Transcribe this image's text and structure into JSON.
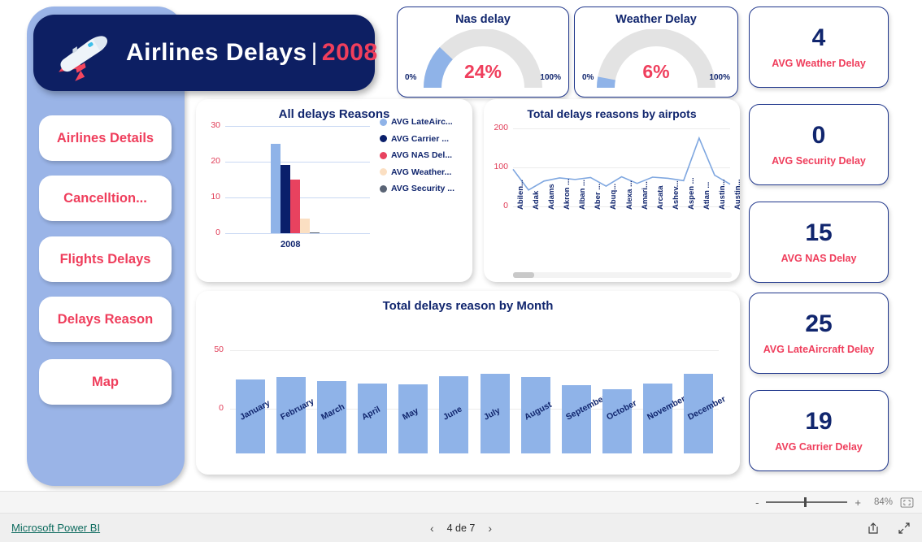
{
  "header": {
    "title_main": "Airlines Delays",
    "title_separator": "|",
    "title_year": "2008",
    "plane_icon": "airplane-icon"
  },
  "sidebar": {
    "items": [
      {
        "label": "Airlines Details"
      },
      {
        "label": "Cancelltion..."
      },
      {
        "label": "Flights Delays"
      },
      {
        "label": "Delays Reason"
      },
      {
        "label": "Map"
      }
    ]
  },
  "gauges": [
    {
      "title": "Nas delay",
      "value_label": "24%",
      "value": 24,
      "min_label": "0%",
      "max_label": "100%"
    },
    {
      "title": "Weather Delay",
      "value_label": "6%",
      "value": 6,
      "min_label": "0%",
      "max_label": "100%"
    }
  ],
  "kpis": [
    {
      "value": "4",
      "label": "AVG Weather Delay"
    },
    {
      "value": "0",
      "label": "AVG Security Delay"
    },
    {
      "value": "15",
      "label": "AVG NAS Delay"
    },
    {
      "value": "25",
      "label": "AVG LateAircraft Delay"
    },
    {
      "value": "19",
      "label": "AVG Carrier Delay"
    }
  ],
  "colors": {
    "navy": "#11266e",
    "banner_navy": "#0d1f63",
    "red": "#ef3e5c",
    "sidebar_blue": "#9ab4e7",
    "bar_light_blue": "#8fb3e8",
    "bar_navy": "#0a1f6b",
    "bar_red": "#e8425f",
    "bar_peach": "#fbdfc2",
    "bar_slate": "#5a6475",
    "gauge_track": "#e3e3e3",
    "link_teal": "#0d6b5e"
  },
  "chart_data": [
    {
      "id": "all-delays-reasons",
      "type": "bar",
      "title": "All delays Reasons",
      "xlabel": "",
      "ylabel": "",
      "categories": [
        "2008"
      ],
      "ylim": [
        0,
        30
      ],
      "yticks": [
        0,
        10,
        20,
        30
      ],
      "grid": true,
      "legend_position": "right",
      "series": [
        {
          "name": "AVG LateAirc...",
          "full_name": "AVG LateAircraft Delay",
          "values": [
            25
          ],
          "color": "#8fb3e8"
        },
        {
          "name": "AVG Carrier ...",
          "full_name": "AVG Carrier Delay",
          "values": [
            19
          ],
          "color": "#0a1f6b"
        },
        {
          "name": "AVG NAS Del...",
          "full_name": "AVG NAS Delay",
          "values": [
            15
          ],
          "color": "#e8425f"
        },
        {
          "name": "AVG Weather...",
          "full_name": "AVG Weather Delay",
          "values": [
            4
          ],
          "color": "#fbdfc2"
        },
        {
          "name": "AVG Security ...",
          "full_name": "AVG Security Delay",
          "values": [
            0.3
          ],
          "color": "#5a6475"
        }
      ]
    },
    {
      "id": "total-delays-by-airports",
      "type": "line",
      "title": "Total delays reasons by airpots",
      "xlabel": "",
      "ylabel": "",
      "ylim": [
        0,
        200
      ],
      "yticks": [
        0,
        100,
        200
      ],
      "grid": true,
      "legend_position": "none",
      "categories": [
        "Abilen...",
        "Adak",
        "Adams",
        "Akron ...",
        "Alban ...",
        "Aber ...",
        "Abuq...",
        "Alexa ...",
        "Amari...",
        "Arcata",
        "Ashev...",
        "Aspen ...",
        "Atlan ...",
        "Austin...",
        "Austin..."
      ],
      "values": [
        95,
        42,
        65,
        73,
        69,
        74,
        52,
        76,
        59,
        75,
        72,
        66,
        175,
        80,
        57
      ],
      "line_color": "#7fa7e0",
      "has_horizontal_scrollbar": true
    },
    {
      "id": "total-delays-by-month",
      "type": "bar",
      "title": "Total delays reason by Month",
      "xlabel": "",
      "ylabel": "",
      "ylim": [
        0,
        75
      ],
      "yticks": [
        0,
        50
      ],
      "grid": true,
      "legend_position": "none",
      "categories": [
        "January",
        "February",
        "March",
        "April",
        "May",
        "June",
        "July",
        "August",
        "September",
        "October",
        "November",
        "December"
      ],
      "values": [
        63,
        65,
        62,
        60,
        59,
        66,
        68,
        65,
        58,
        55,
        60,
        68
      ],
      "bar_color": "#8fb3e8"
    }
  ],
  "zoombar": {
    "minus": "-",
    "plus": "+",
    "zoom_level": "84%",
    "fit_icon": "fit-to-page-icon"
  },
  "statusbar": {
    "link": "Microsoft Power BI",
    "prev_icon": "chevron-left-icon",
    "next_icon": "chevron-right-icon",
    "page_label": "4 de 7",
    "share_icon": "share-icon",
    "fullscreen_icon": "fullscreen-icon"
  }
}
